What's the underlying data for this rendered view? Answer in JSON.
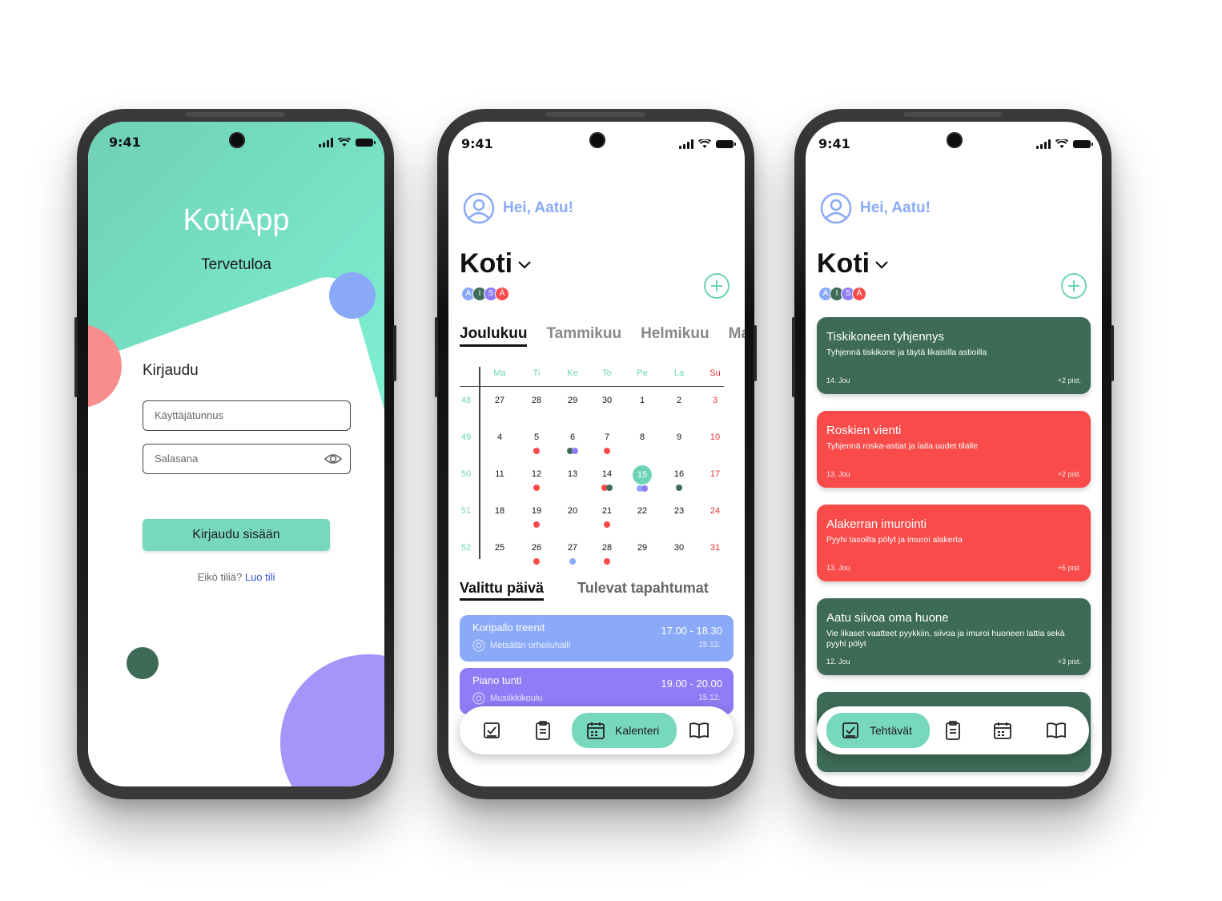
{
  "status": {
    "time": "9:41"
  },
  "colors": {
    "mint": "#78d8bd",
    "mint_dark": "#6fd3b6",
    "blue": "#8aaaf7",
    "purple": "#8f7cf6",
    "dark_green": "#3e6b57",
    "red": "#fa4b4b",
    "coral": "#f88d8d"
  },
  "login": {
    "app_title": "KotiApp",
    "welcome": "Tervetuloa",
    "heading": "Kirjaudu",
    "username_placeholder": "Käyttäjätunnus",
    "password_placeholder": "Salasana",
    "submit_label": "Kirjaudu sisään",
    "no_account_text": "Eikö tiliä?",
    "create_account_link": "Luo tili"
  },
  "header": {
    "greeting": "Hei, Aatu!",
    "home_name": "Koti",
    "members": [
      {
        "initial": "A",
        "color": "#8aaaf7"
      },
      {
        "initial": "I",
        "color": "#3e6b57"
      },
      {
        "initial": "S",
        "color": "#8f7cf6"
      },
      {
        "initial": "Ä",
        "color": "#fa4b4b"
      }
    ]
  },
  "calendar": {
    "months": [
      "Joulukuu",
      "Tammikuu",
      "Helmikuu",
      "Ma"
    ],
    "weekdays": [
      "Ma",
      "Ti",
      "Ke",
      "To",
      "Pe",
      "La",
      "Su"
    ],
    "weeks": [
      {
        "no": "48",
        "days": [
          "27",
          "28",
          "29",
          "30",
          "1",
          "2",
          "3"
        ]
      },
      {
        "no": "49",
        "days": [
          "4",
          "5",
          "6",
          "7",
          "8",
          "9",
          "10"
        ]
      },
      {
        "no": "50",
        "days": [
          "11",
          "12",
          "13",
          "14",
          "15",
          "16",
          "17"
        ]
      },
      {
        "no": "51",
        "days": [
          "18",
          "19",
          "20",
          "21",
          "22",
          "23",
          "24"
        ]
      },
      {
        "no": "52",
        "days": [
          "25",
          "26",
          "27",
          "28",
          "29",
          "30",
          "31"
        ]
      }
    ],
    "today": "15",
    "tabs": [
      "Valittu päivä",
      "Tulevat tapahtumat"
    ],
    "events": [
      {
        "title": "Koripallo treenit",
        "time": "17.00 - 18.30",
        "place": "Metsälän urheiluhalli",
        "date": "15.12.",
        "color": "#8aaaf7"
      },
      {
        "title": "Piano tunti",
        "time": "19.00 - 20.00",
        "place": "Musiikkikoulu",
        "date": "15.12.",
        "color": "#8f7cf6"
      }
    ]
  },
  "nav": {
    "calendar_label": "Kalenteri",
    "tasks_label": "Tehtävät"
  },
  "tasks": [
    {
      "title": "Tiskikoneen tyhjennys",
      "desc": "Tyhjennä tiskikone ja täytä likaisilla astioilla",
      "date": "14. Jou",
      "points": "+2 pist.",
      "color": "green"
    },
    {
      "title": "Roskien vienti",
      "desc": "Tyhjennä roska-astiat ja laita uudet tilalle",
      "date": "13. Jou",
      "points": "+2 pist.",
      "color": "red"
    },
    {
      "title": "Alakerran imurointi",
      "desc": "Pyyhi tasoilta pölyt ja imuroi alakerta",
      "date": "13. Jou",
      "points": "+5 pist.",
      "color": "red"
    },
    {
      "title": "Aatu siivoa oma huone",
      "desc": "Vie likaset vaatteet pyykkiin, siivoa ja imuroi huoneen lattia sekä pyyhi pölyt",
      "date": "12. Jou",
      "points": "+3 pist.",
      "color": "green"
    }
  ]
}
